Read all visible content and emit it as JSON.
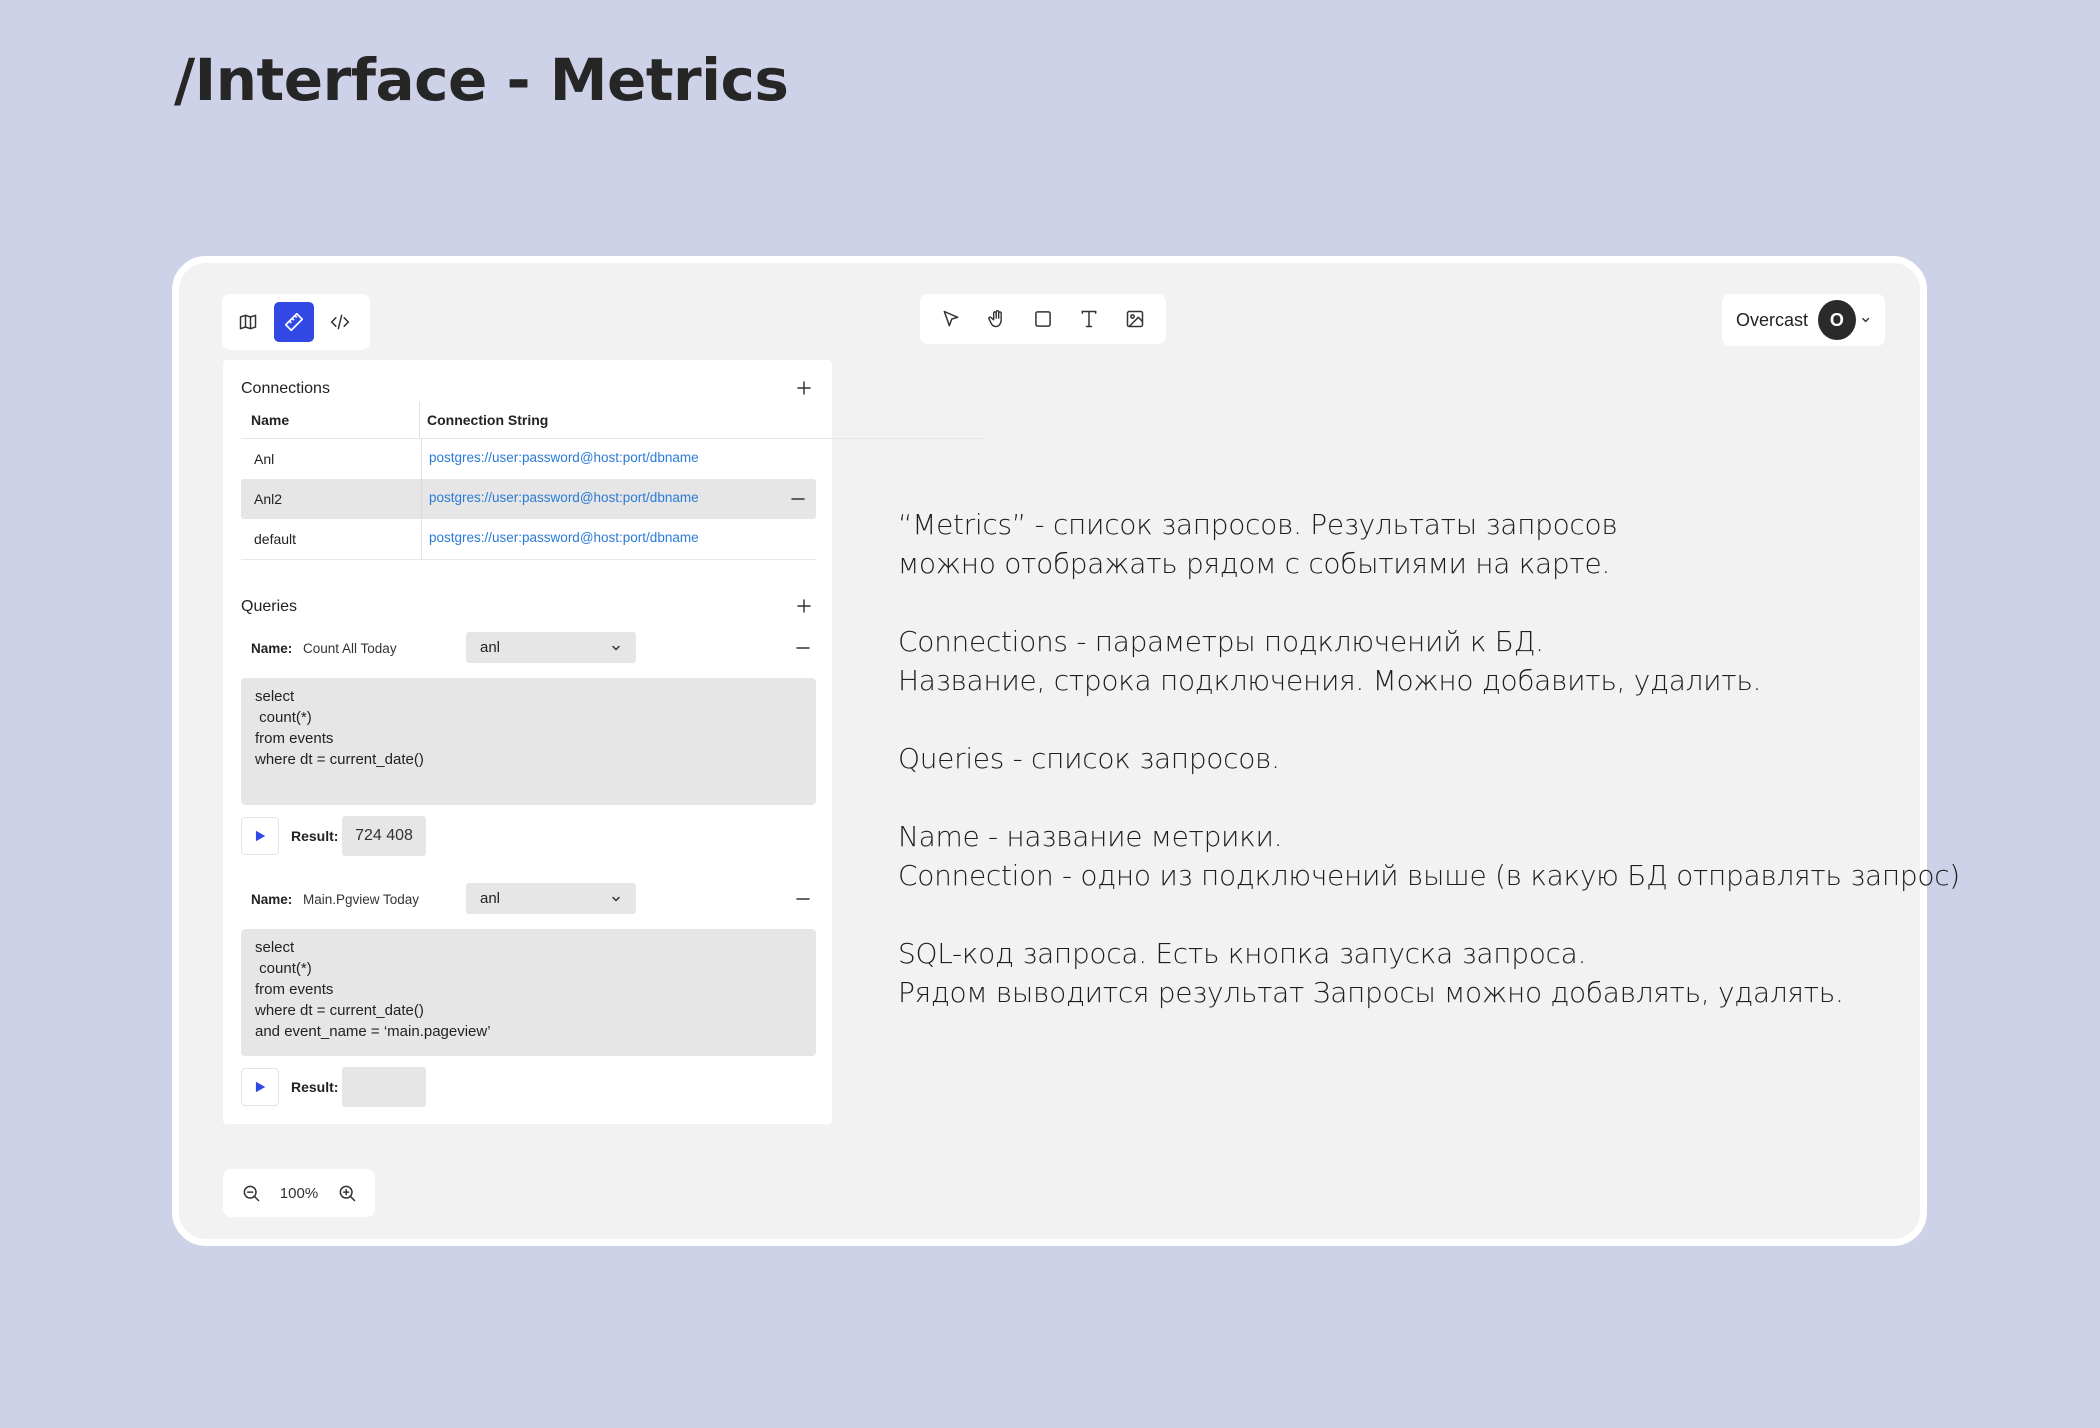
{
  "page": {
    "title": "/Interface - Metrics"
  },
  "toolbar": {
    "modes": [
      {
        "icon": "map-icon",
        "active": false
      },
      {
        "icon": "ruler-icon",
        "active": true
      },
      {
        "icon": "code-icon",
        "active": false
      }
    ],
    "tools": [
      "cursor-icon",
      "hand-icon",
      "rectangle-icon",
      "text-icon",
      "image-icon"
    ]
  },
  "profile": {
    "name": "Overcast",
    "avatar_letter": "O"
  },
  "connections": {
    "heading": "Connections",
    "columns": {
      "name": "Name",
      "string": "Connection String"
    },
    "rows": [
      {
        "name": "Anl",
        "string": "postgres://user:password@host:port/dbname"
      },
      {
        "name": "Anl2",
        "string": "postgres://user:password@host:port/dbname"
      },
      {
        "name": "default",
        "string": "postgres://user:password@host:port/dbname"
      }
    ]
  },
  "queries": {
    "heading": "Queries",
    "name_label": "Name:",
    "result_label": "Result:",
    "items": [
      {
        "name": "Count All Today",
        "connection": "anl",
        "sql": "select\n count(*)\nfrom events\nwhere dt = current_date()",
        "result": "724 408"
      },
      {
        "name": "Main.Pgview Today",
        "connection": "anl",
        "sql": "select\n count(*)\nfrom events\nwhere dt = current_date()\nand event_name = ‘main.pageview’",
        "result": ""
      }
    ]
  },
  "zoom": {
    "value": "100%"
  },
  "description": {
    "p1": "“Metrics” - список запросов. Результаты запросов можно отображать рядом с событиями на карте.",
    "p2a": "Connections - параметры подключений к БД.",
    "p2b": "Название, строка подключения. Можно добавить, удалить.",
    "p3": "Queries - список запросов.",
    "p4a": "Name - название метрики.",
    "p4b": "Connection - одно из подключений выше (в какую БД отправлять запрос)",
    "p5a": "SQL-код запроса. Есть кнопка запуска запроса.",
    "p5b": "Рядом выводится результат  Запросы можно добавлять, удалять."
  },
  "colors": {
    "accent": "#3248e4",
    "link": "#2a7bd8",
    "background": "#cdd2e8"
  }
}
